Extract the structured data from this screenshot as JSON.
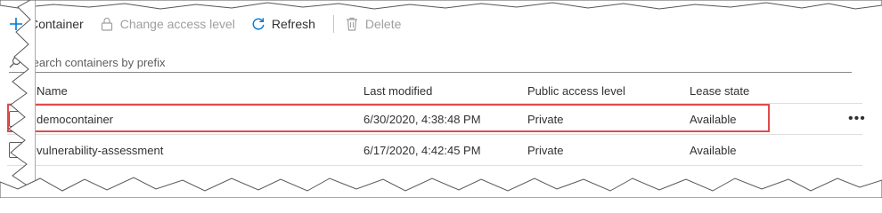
{
  "toolbar": {
    "container_label": "Container",
    "change_access_label": "Change access level",
    "refresh_label": "Refresh",
    "delete_label": "Delete"
  },
  "search": {
    "placeholder": "Search containers by prefix"
  },
  "table": {
    "headers": {
      "name": "Name",
      "last_modified": "Last modified",
      "public_access": "Public access level",
      "lease_state": "Lease state"
    },
    "rows": [
      {
        "name": "democontainer",
        "last_modified": "6/30/2020, 4:38:48 PM",
        "public_access": "Private",
        "lease_state": "Available",
        "more": "•••",
        "highlighted": true
      },
      {
        "name": "vulnerability-assessment",
        "last_modified": "6/17/2020, 4:42:45 PM",
        "public_access": "Private",
        "lease_state": "Available",
        "more": "",
        "highlighted": false
      }
    ]
  },
  "colors": {
    "accent": "#0078d4",
    "disabled": "#a19f9d",
    "highlight_border": "#e04b4b"
  },
  "icons": {
    "add": "add-icon",
    "lock": "lock-icon",
    "refresh": "refresh-icon",
    "delete": "trash-icon",
    "search": "search-icon",
    "more": "more-icon"
  }
}
